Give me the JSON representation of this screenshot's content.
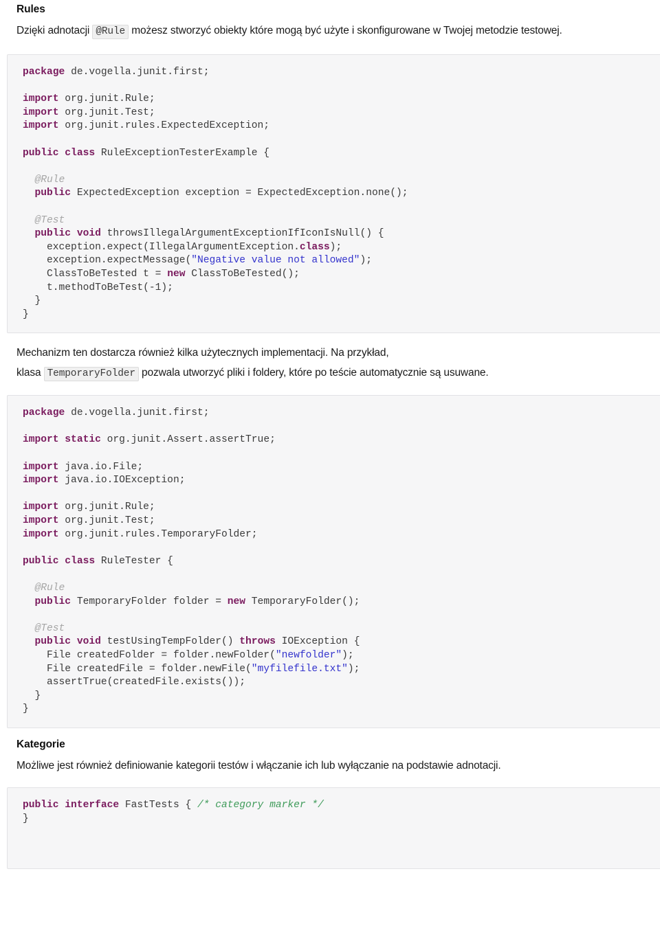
{
  "document": {
    "sections": [
      {
        "id": "rules",
        "heading": "Rules",
        "paragraph_before": "Dzięki adnotacji ",
        "inline_code": "@Rule",
        "paragraph_after": " możesz stworzyć obiekty które mogą być użyte i skonfigurowane w Twojej metodzie testowej."
      },
      {
        "id": "kategorie",
        "heading": "Kategorie",
        "paragraph": "Możliwe jest również definiowanie kategorii testów i włączanie ich lub wyłączanie na podstawie adnotacji."
      }
    ],
    "middle_paragraph": {
      "line1": "Mechanizm ten dostarcza również kilka użytecznych implementacji. Na przykład,",
      "line2_before": "klasa ",
      "inline_code": "TemporaryFolder",
      "line2_after": " pozwala utworzyć pliki i foldery, które po teście automatycznie są usuwane."
    }
  },
  "code_blocks": [
    {
      "id": "rule-exception-tester-example",
      "language": "java",
      "lines": [
        [
          {
            "t": "package",
            "c": "kw"
          },
          {
            "t": " de.vogella.junit.first;",
            "c": "pln"
          }
        ],
        [],
        [
          {
            "t": "import",
            "c": "kw"
          },
          {
            "t": " org.junit.Rule;",
            "c": "pln"
          }
        ],
        [
          {
            "t": "import",
            "c": "kw"
          },
          {
            "t": " org.junit.Test;",
            "c": "pln"
          }
        ],
        [
          {
            "t": "import",
            "c": "kw"
          },
          {
            "t": " org.junit.rules.ExpectedException;",
            "c": "pln"
          }
        ],
        [],
        [
          {
            "t": "public class",
            "c": "kw"
          },
          {
            "t": " RuleExceptionTesterExample {",
            "c": "pln"
          }
        ],
        [],
        [
          {
            "t": "  @Rule",
            "c": "ann"
          }
        ],
        [
          {
            "t": "  public",
            "c": "kw"
          },
          {
            "t": " ExpectedException exception = ExpectedException.none();",
            "c": "pln"
          }
        ],
        [],
        [
          {
            "t": "  @Test",
            "c": "ann"
          }
        ],
        [
          {
            "t": "  public void",
            "c": "kw"
          },
          {
            "t": " throwsIllegalArgumentExceptionIfIconIsNull() {",
            "c": "pln"
          }
        ],
        [
          {
            "t": "    exception.expect(IllegalArgumentException.",
            "c": "pln"
          },
          {
            "t": "class",
            "c": "kw"
          },
          {
            "t": ");",
            "c": "pln"
          }
        ],
        [
          {
            "t": "    exception.expectMessage(",
            "c": "pln"
          },
          {
            "t": "\"Negative value not allowed\"",
            "c": "str"
          },
          {
            "t": ");",
            "c": "pln"
          }
        ],
        [
          {
            "t": "    ClassToBeTested t = ",
            "c": "pln"
          },
          {
            "t": "new",
            "c": "kw"
          },
          {
            "t": " ClassToBeTested();",
            "c": "pln"
          }
        ],
        [
          {
            "t": "    t.methodToBeTest(-1);",
            "c": "pln"
          }
        ],
        [
          {
            "t": "  }",
            "c": "pln"
          }
        ],
        [
          {
            "t": "}",
            "c": "pln"
          }
        ]
      ]
    },
    {
      "id": "rule-tester",
      "language": "java",
      "lines": [
        [
          {
            "t": "package",
            "c": "kw"
          },
          {
            "t": " de.vogella.junit.first;",
            "c": "pln"
          }
        ],
        [],
        [
          {
            "t": "import static",
            "c": "kw"
          },
          {
            "t": " org.junit.Assert.assertTrue;",
            "c": "pln"
          }
        ],
        [],
        [
          {
            "t": "import",
            "c": "kw"
          },
          {
            "t": " java.io.File;",
            "c": "pln"
          }
        ],
        [
          {
            "t": "import",
            "c": "kw"
          },
          {
            "t": " java.io.IOException;",
            "c": "pln"
          }
        ],
        [],
        [
          {
            "t": "import",
            "c": "kw"
          },
          {
            "t": " org.junit.Rule;",
            "c": "pln"
          }
        ],
        [
          {
            "t": "import",
            "c": "kw"
          },
          {
            "t": " org.junit.Test;",
            "c": "pln"
          }
        ],
        [
          {
            "t": "import",
            "c": "kw"
          },
          {
            "t": " org.junit.rules.TemporaryFolder;",
            "c": "pln"
          }
        ],
        [],
        [
          {
            "t": "public class",
            "c": "kw"
          },
          {
            "t": " RuleTester {",
            "c": "pln"
          }
        ],
        [],
        [
          {
            "t": "  @Rule",
            "c": "ann"
          }
        ],
        [
          {
            "t": "  public",
            "c": "kw"
          },
          {
            "t": " TemporaryFolder folder = ",
            "c": "pln"
          },
          {
            "t": "new",
            "c": "kw"
          },
          {
            "t": " TemporaryFolder();",
            "c": "pln"
          }
        ],
        [],
        [
          {
            "t": "  @Test",
            "c": "ann"
          }
        ],
        [
          {
            "t": "  public void",
            "c": "kw"
          },
          {
            "t": " testUsingTempFolder() ",
            "c": "pln"
          },
          {
            "t": "throws",
            "c": "kw"
          },
          {
            "t": " IOException {",
            "c": "pln"
          }
        ],
        [
          {
            "t": "    File createdFolder = folder.newFolder(",
            "c": "pln"
          },
          {
            "t": "\"newfolder\"",
            "c": "str"
          },
          {
            "t": ");",
            "c": "pln"
          }
        ],
        [
          {
            "t": "    File createdFile = folder.newFile(",
            "c": "pln"
          },
          {
            "t": "\"myfilefile.txt\"",
            "c": "str"
          },
          {
            "t": ");",
            "c": "pln"
          }
        ],
        [
          {
            "t": "    assertTrue(createdFile.exists());",
            "c": "pln"
          }
        ],
        [
          {
            "t": "  }",
            "c": "pln"
          }
        ],
        [
          {
            "t": "}",
            "c": "pln"
          }
        ]
      ]
    },
    {
      "id": "fast-tests-interface",
      "language": "java",
      "lines": [
        [
          {
            "t": "public interface",
            "c": "kw"
          },
          {
            "t": " FastTests { ",
            "c": "pln"
          },
          {
            "t": "/* category marker */",
            "c": "cmt"
          }
        ],
        [
          {
            "t": "}",
            "c": "pln"
          }
        ]
      ]
    }
  ]
}
